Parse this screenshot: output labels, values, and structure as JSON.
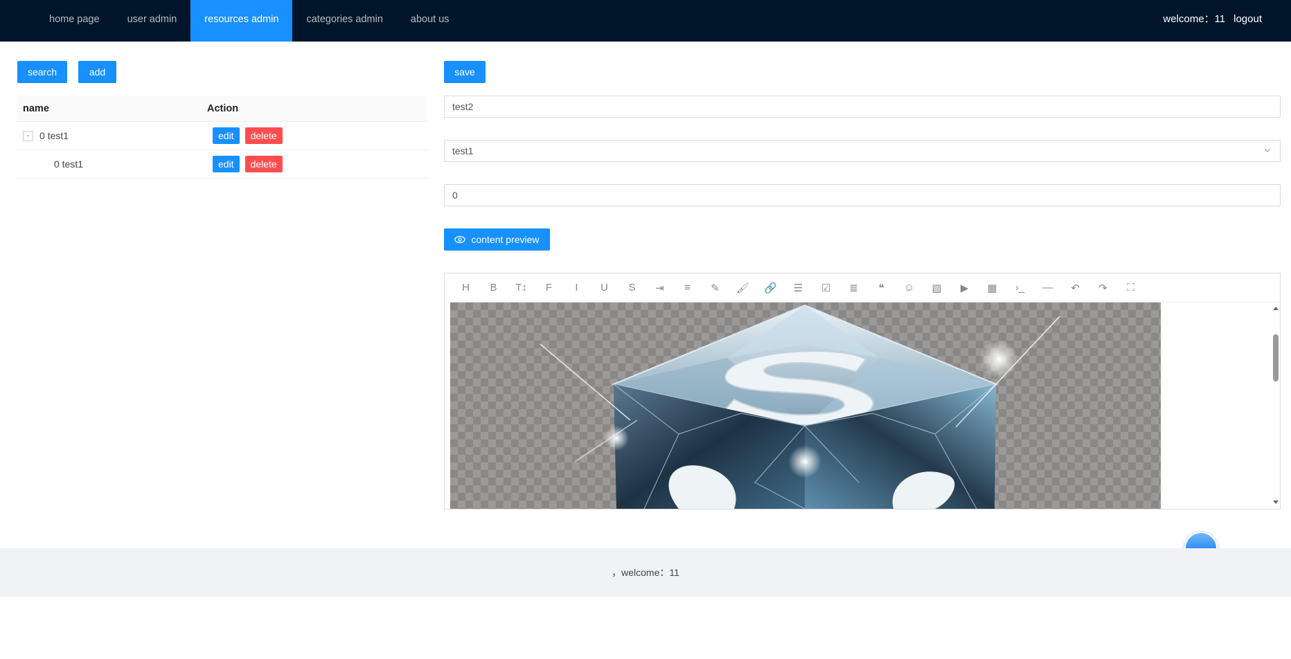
{
  "nav": {
    "items": [
      {
        "label": "home page"
      },
      {
        "label": "user admin"
      },
      {
        "label": "resources admin"
      },
      {
        "label": "categories admin"
      },
      {
        "label": "about us"
      }
    ],
    "active_index": 2,
    "welcome": "welcome：11",
    "logout": "logout"
  },
  "left": {
    "search_label": "search",
    "add_label": "add",
    "table": {
      "columns": [
        "name",
        "Action"
      ],
      "rows": [
        {
          "expander": "-",
          "name": "0 test1",
          "edit": "edit",
          "delete": "delete"
        },
        {
          "name": "0 test1",
          "edit": "edit",
          "delete": "delete"
        }
      ]
    }
  },
  "form": {
    "save_label": "save",
    "title_value": "test2",
    "category_value": "test1",
    "order_value": "0",
    "preview_label": "content preview"
  },
  "editor": {
    "toolbar": [
      "heading-icon",
      "bold-icon",
      "font-size-icon",
      "font-family-icon",
      "italic-icon",
      "underline-icon",
      "strikethrough-icon",
      "indent-icon",
      "line-height-icon",
      "highlight-icon",
      "paint-brush-icon",
      "link-icon",
      "bullet-list-icon",
      "checklist-icon",
      "align-icon",
      "quote-icon",
      "emoji-icon",
      "image-icon",
      "video-icon",
      "table-icon",
      "code-icon",
      "horizontal-rule-icon",
      "undo-icon",
      "redo-icon",
      "fullscreen-icon"
    ],
    "toolbar_glyphs": [
      "H",
      "B",
      "T↕",
      "F",
      "I",
      "U",
      "S",
      "⇥",
      "≡",
      "✎",
      "🖌",
      "🔗",
      "☰",
      "☑",
      "≣",
      "❝",
      "☺",
      "▨",
      "▶",
      "▦",
      "›_",
      "—",
      "↶",
      "↷",
      "⛶"
    ]
  },
  "footer": {
    "text": "，welcome：11"
  },
  "colors": {
    "nav_bg": "#001529",
    "accent": "#1890ff",
    "danger": "#ff4d4f",
    "footer_bg": "#f0f2f5"
  }
}
